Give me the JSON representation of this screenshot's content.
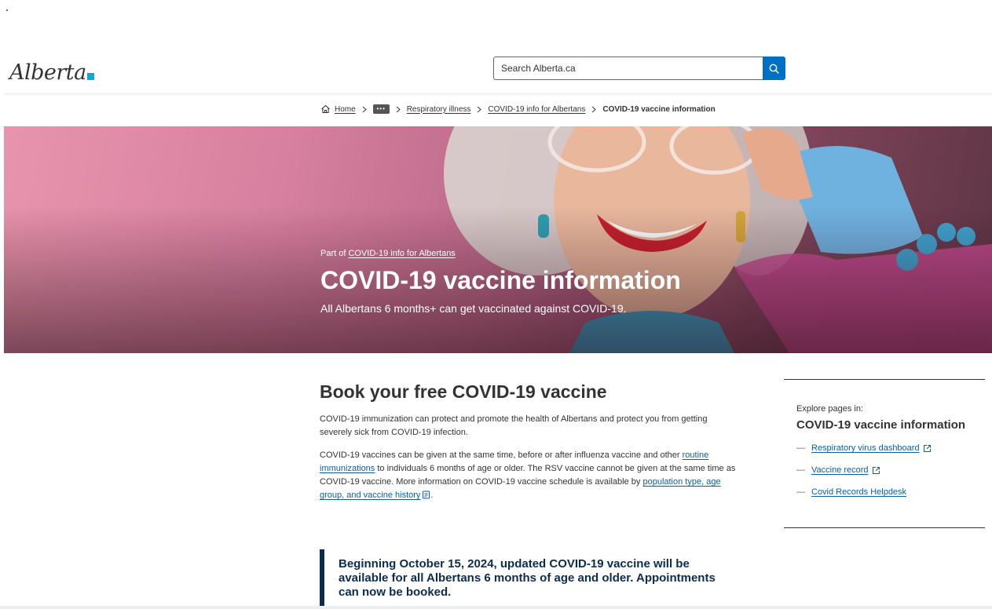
{
  "brand": {
    "logo_text": "Alberta",
    "accent_color": "#0aa9d8"
  },
  "search": {
    "placeholder": "Search Alberta.ca",
    "icon": "search-icon",
    "button_color": "#0070c4"
  },
  "breadcrumb": {
    "home": "Home",
    "ellipsis": "•••",
    "items": [
      "Respiratory illness",
      "COVID-19 info for Albertans"
    ],
    "current": "COVID-19 vaccine information"
  },
  "hero": {
    "part_prefix": "Part of ",
    "part_link": "COVID-19 info for Albertans",
    "title": "COVID-19 vaccine information",
    "subtitle": "All Albertans 6 months+ can get vaccinated against COVID-19."
  },
  "main": {
    "heading": "Book your free COVID-19 vaccine",
    "para1": "COVID-19 immunization can protect and promote the health of Albertans and protect you from getting severely sick from COVID-19 infection.",
    "para2_a": "COVID-19 vaccines can be given at the same time, before or after influenza vaccine and other ",
    "para2_link1": "routine immunizations",
    "para2_b": " to individuals 6 months of age or older. The RSV vaccine cannot be given at the same time as COVID-19 vaccine. More information on COVID-19 vaccine schedule is available by ",
    "para2_link2": "population type, age group, and vaccine history",
    "para2_c": ".",
    "link_color": "#0b5ea8"
  },
  "callout": {
    "text": "Beginning October 15, 2024, updated COVID-19 vaccine will be available for all Albertans 6 months of age and older. Appointments can now be booked.",
    "border_color": "#0b2c4e"
  },
  "side_nav": {
    "kicker": "Explore pages in:",
    "title": "COVID-19 vaccine information",
    "items": [
      {
        "label": "Respiratory virus dashboard",
        "external": true
      },
      {
        "label": "Vaccine record",
        "external": true
      },
      {
        "label": "Covid Records Helpdesk",
        "external": false
      }
    ]
  }
}
